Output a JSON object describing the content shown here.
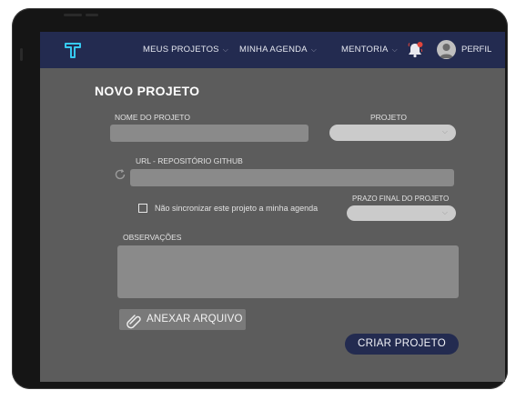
{
  "navbar": {
    "items": [
      {
        "label": "MEUS PROJETOS"
      },
      {
        "label": "MINHA AGENDA"
      },
      {
        "label": "MENTORIA"
      }
    ],
    "profile_label": "PERFIL"
  },
  "form": {
    "title": "NOVO PROJETO",
    "project_name_label": "NOME DO PROJETO",
    "project_name_value": "",
    "project_select_label": "PROJETO",
    "github_label": "URL - REPOSITÓRIO GITHUB",
    "github_value": "",
    "no_sync_label": "Não sincronizar este projeto a minha agenda",
    "no_sync_checked": false,
    "deadline_label": "PRAZO FINAL DO PROJETO",
    "notes_label": "OBSERVAÇÕES",
    "notes_value": "",
    "attach_label": "ANEXAR ARQUIVO",
    "create_label": "CRIAR PROJETO"
  },
  "colors": {
    "navbar": "#232b50",
    "screen_bg": "#5c5c5c",
    "input_bg": "#8a8a8a",
    "select_bg": "#cbcbcb",
    "logo_accent": "#36c9f0",
    "notification_dot": "#e0463c"
  },
  "icons": {
    "logo": "t-logo-icon",
    "notifications": "bell-icon",
    "avatar": "user-avatar-icon",
    "refresh": "refresh-icon",
    "attach": "paperclip-icon",
    "dropdown": "chevron-down-icon"
  }
}
